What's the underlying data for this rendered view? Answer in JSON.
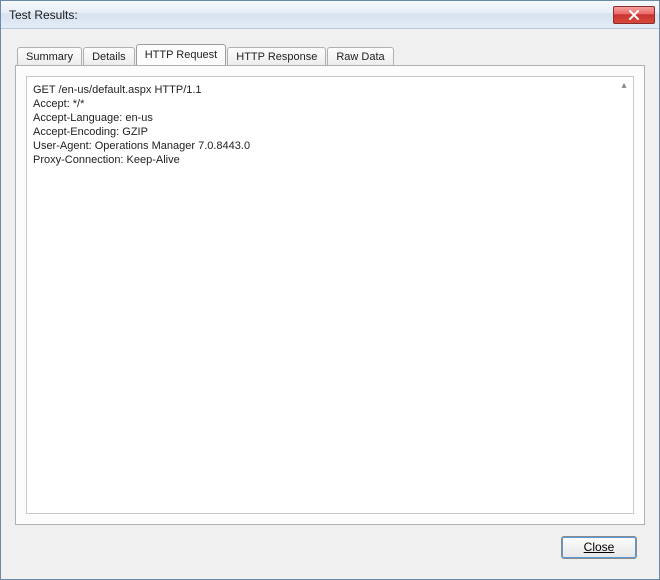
{
  "window": {
    "title": "Test Results:"
  },
  "tabs": [
    {
      "label": "Summary",
      "active": false
    },
    {
      "label": "Details",
      "active": false
    },
    {
      "label": "HTTP Request",
      "active": true
    },
    {
      "label": "HTTP Response",
      "active": false
    },
    {
      "label": "Raw Data",
      "active": false
    }
  ],
  "http_request": {
    "lines": [
      "GET /en-us/default.aspx HTTP/1.1",
      "Accept: */*",
      "Accept-Language: en-us",
      "Accept-Encoding: GZIP",
      "User-Agent: Operations Manager 7.0.8443.0",
      "Proxy-Connection: Keep-Alive"
    ]
  },
  "buttons": {
    "close": "Close"
  }
}
